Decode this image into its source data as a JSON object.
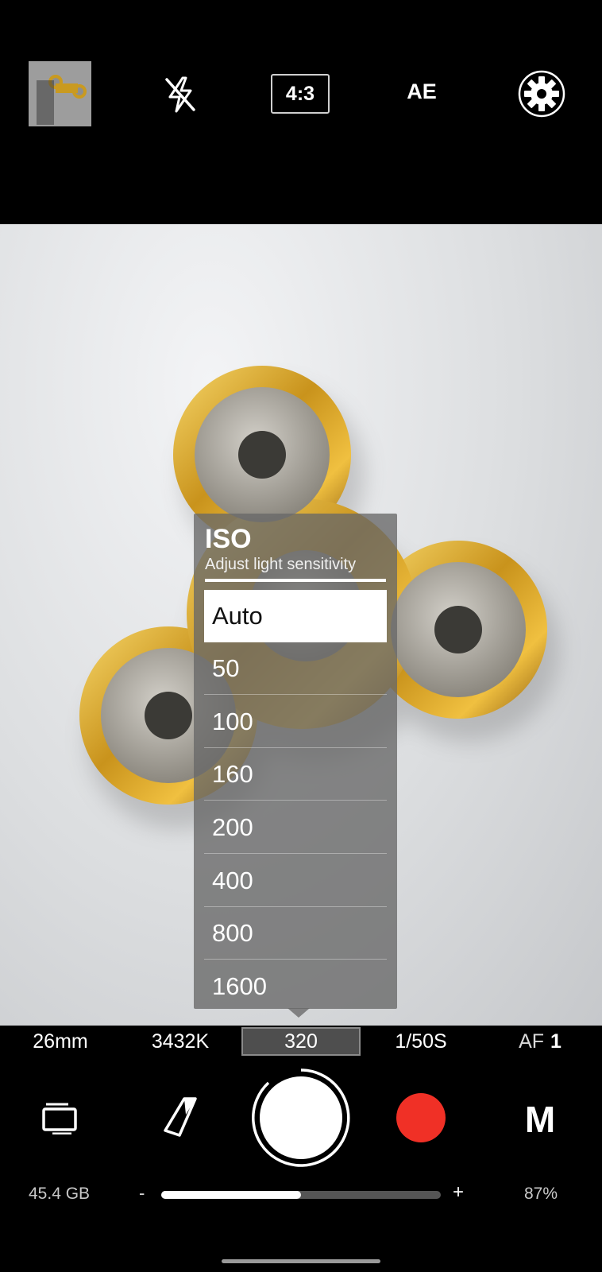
{
  "top_bar": {
    "thumbnail_icon": "last-photo-thumbnail",
    "flash_icon": "flash-off-icon",
    "aspect_ratio": "4:3",
    "exposure_label": "AE",
    "settings_icon": "gear-icon"
  },
  "iso_menu": {
    "title": "ISO",
    "subtitle": "Adjust light sensitivity",
    "options": [
      "Auto",
      "50",
      "100",
      "160",
      "200",
      "400",
      "800",
      "1600"
    ],
    "selected": "Auto"
  },
  "parameters": {
    "focal_length": "26mm",
    "white_balance": "3432K",
    "iso": "320",
    "shutter_speed": "1/50S",
    "af_prefix": "AF",
    "af_value": "1"
  },
  "controls": {
    "gallery_icon": "gallery-icon",
    "tag_icon": "tag-icon",
    "shutter_icon": "shutter-button",
    "record_icon": "record-icon",
    "mode_label": "M"
  },
  "status": {
    "storage": "45.4 GB",
    "zoom_minus": "-",
    "zoom_plus": "+",
    "zoom_level": 0.5,
    "battery": "87%"
  },
  "colors": {
    "record": "#f03026",
    "spinner_gold": "#d4a52a",
    "panel": "#686868"
  }
}
